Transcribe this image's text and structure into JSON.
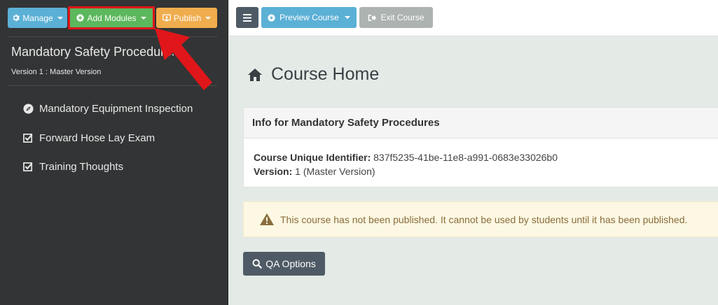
{
  "sidebar": {
    "buttons": {
      "manage": "Manage",
      "add_modules": "Add Modules",
      "publish": "Publish"
    },
    "course_title": "Mandatory Safety Procedures",
    "version": "Version 1 : Master Version",
    "modules": [
      {
        "label": "Mandatory Equipment Inspection",
        "icon": "compass-icon"
      },
      {
        "label": "Forward Hose Lay Exam",
        "icon": "checkbox-icon"
      },
      {
        "label": "Training Thoughts",
        "icon": "checkbox-icon"
      }
    ]
  },
  "topbar": {
    "preview": "Preview Course",
    "exit": "Exit Course"
  },
  "main": {
    "page_title": "Course Home",
    "info_panel": {
      "heading": "Info for Mandatory Safety Procedures",
      "identifier_label": "Course Unique Identifier:",
      "identifier_value": "837f5235-41be-11e8-a991-0683e33026b0",
      "version_label": "Version:",
      "version_value": "1 (Master Version)"
    },
    "alert": "This course has not been published. It cannot be used by students until it has been published.",
    "qa_button": "QA Options"
  },
  "colors": {
    "sidebar_bg": "#333435",
    "info_blue": "#5bb0d5",
    "success_green": "#5cb85c",
    "warning_orange": "#f0ad4e",
    "highlight_red": "#e0161a",
    "dark_button": "#4e5a65",
    "content_bg": "#e4eae6"
  }
}
